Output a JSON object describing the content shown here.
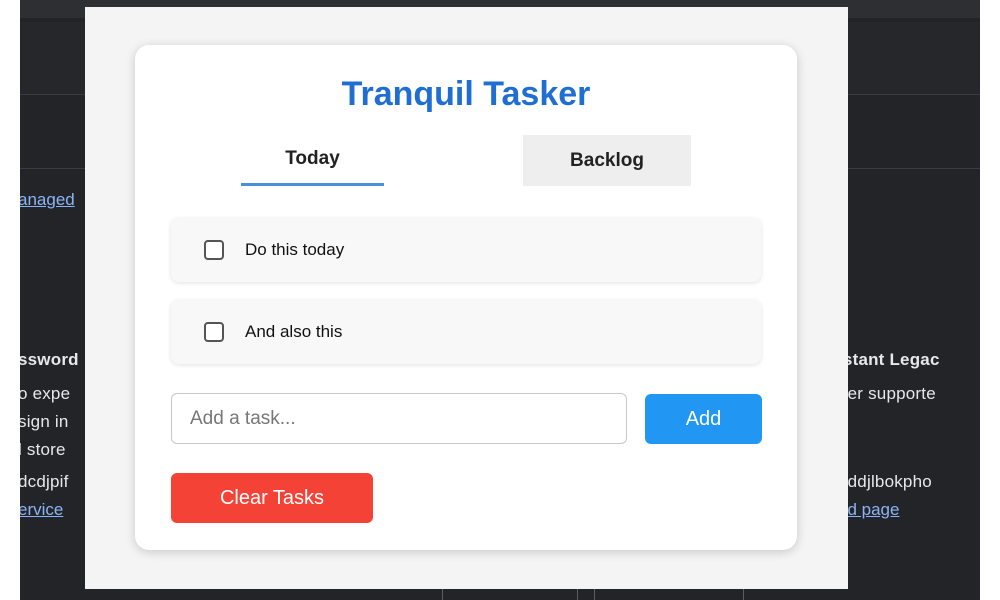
{
  "background": {
    "left_texts": [
      "ssword",
      "o expe",
      "sign in",
      "l store",
      "dcdjpif"
    ],
    "left_links": [
      "anaged",
      "ervice"
    ],
    "right_texts": [
      "istant Legac",
      "ger supporte",
      "dddjlbokpho"
    ],
    "right_links": [
      "nd page"
    ]
  },
  "app": {
    "title": "Tranquil Tasker",
    "tabs": [
      {
        "label": "Today",
        "active": true
      },
      {
        "label": "Backlog",
        "active": false
      }
    ],
    "tasks": [
      {
        "label": "Do this today",
        "checked": false
      },
      {
        "label": "And also this",
        "checked": false
      }
    ],
    "input": {
      "placeholder": "Add a task...",
      "value": ""
    },
    "add_label": "Add",
    "clear_label": "Clear Tasks"
  },
  "colors": {
    "title": "#1f6ed4",
    "add_button": "#2196f3",
    "clear_button": "#f44336",
    "active_tab_underline": "#4a90d9"
  }
}
